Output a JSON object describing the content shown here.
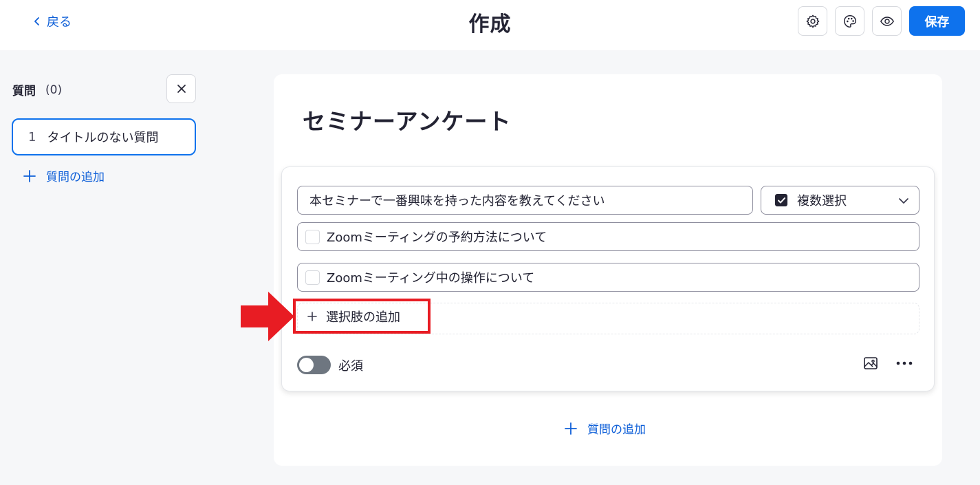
{
  "header": {
    "back_label": "戻る",
    "title": "作成",
    "save_label": "保存",
    "icons": [
      "gear-icon",
      "palette-icon",
      "eye-icon"
    ]
  },
  "sidebar": {
    "heading": "質問",
    "count": "(0)",
    "items": [
      {
        "number": "1",
        "label": "タイトルのない質問"
      }
    ],
    "add_question_label": "質問の追加"
  },
  "survey": {
    "title": "セミナーアンケート",
    "question": {
      "text": "本セミナーで一番興味を持った内容を教えてください",
      "type_label": "複数選択",
      "options": [
        "Zoomミーティングの予約方法について",
        "Zoomミーティング中の操作について"
      ],
      "add_choice_label": "選択肢の追加",
      "required_label": "必須",
      "required_on": false
    },
    "add_question_label": "質問の追加"
  },
  "colors": {
    "accent": "#0e72ed",
    "link": "#0e5fd8",
    "highlight": "#e81c23"
  }
}
